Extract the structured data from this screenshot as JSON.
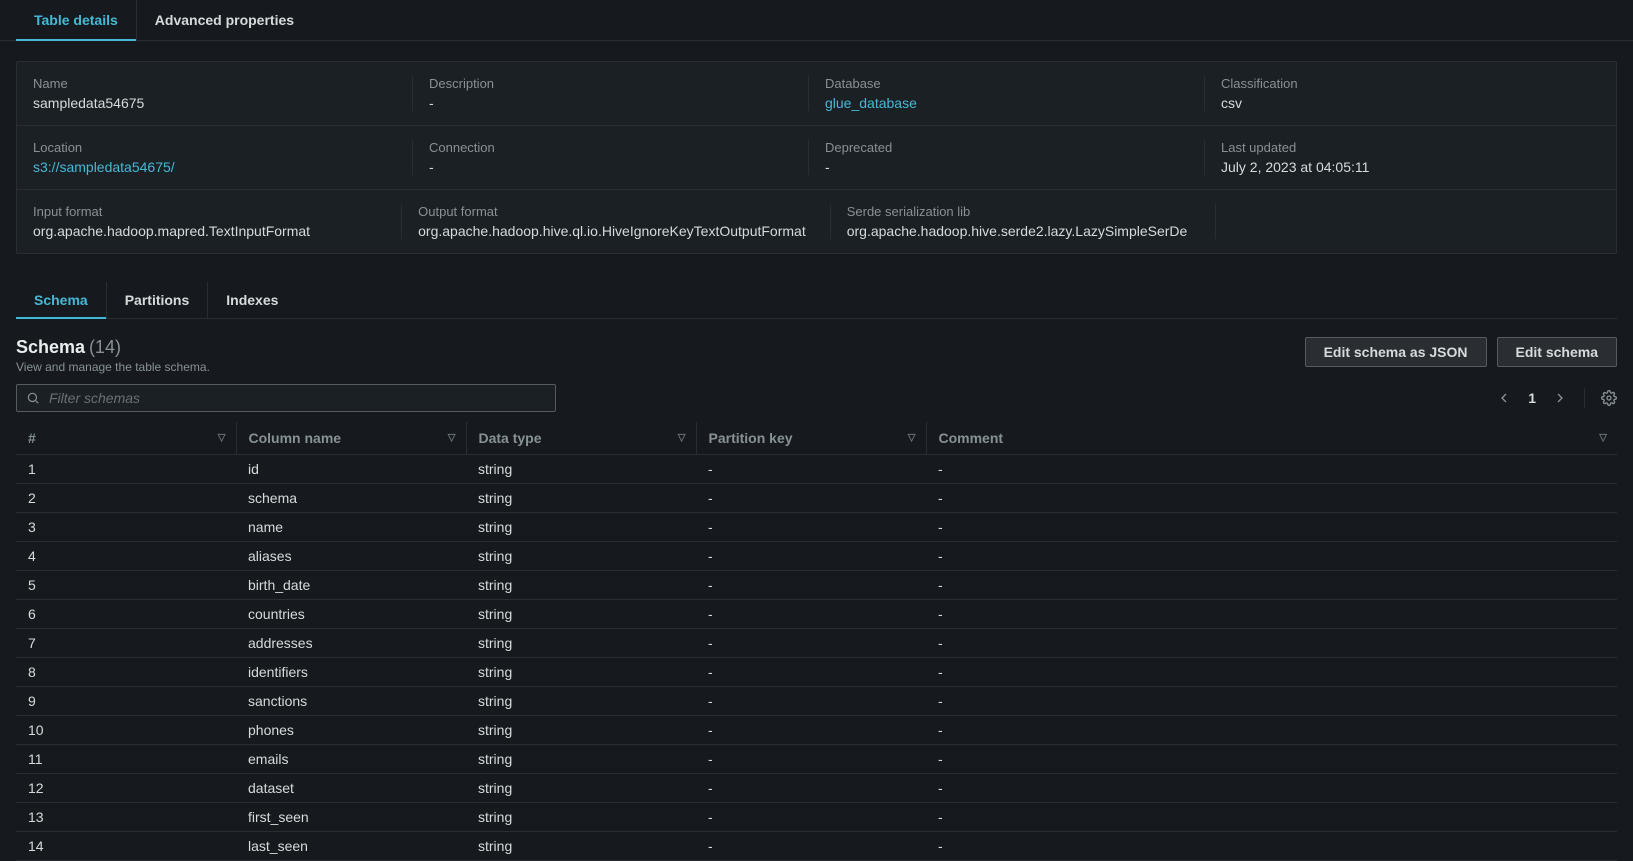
{
  "topTabs": {
    "details": "Table details",
    "advanced": "Advanced properties"
  },
  "details": {
    "row1": {
      "name": {
        "label": "Name",
        "value": "sampledata54675"
      },
      "description": {
        "label": "Description",
        "value": "-"
      },
      "database": {
        "label": "Database",
        "value": "glue_database"
      },
      "classification": {
        "label": "Classification",
        "value": "csv"
      }
    },
    "row2": {
      "location": {
        "label": "Location",
        "value": "s3://sampledata54675/"
      },
      "connection": {
        "label": "Connection",
        "value": "-"
      },
      "deprecated": {
        "label": "Deprecated",
        "value": "-"
      },
      "lastUpdated": {
        "label": "Last updated",
        "value": "July 2, 2023 at 04:05:11"
      }
    },
    "row3": {
      "inputFormat": {
        "label": "Input format",
        "value": "org.apache.hadoop.mapred.TextInputFormat"
      },
      "outputFormat": {
        "label": "Output format",
        "value": "org.apache.hadoop.hive.ql.io.HiveIgnoreKeyTextOutputFormat"
      },
      "serde": {
        "label": "Serde serialization lib",
        "value": "org.apache.hadoop.hive.serde2.lazy.LazySimpleSerDe"
      }
    }
  },
  "subTabs": {
    "schema": "Schema",
    "partitions": "Partitions",
    "indexes": "Indexes"
  },
  "schemaHeader": {
    "title": "Schema",
    "count": "(14)",
    "subtitle": "View and manage the table schema.",
    "editJson": "Edit schema as JSON",
    "edit": "Edit schema"
  },
  "search": {
    "placeholder": "Filter schemas"
  },
  "pager": {
    "page": "1"
  },
  "columns": {
    "num": "#",
    "name": "Column name",
    "type": "Data type",
    "partition": "Partition key",
    "comment": "Comment"
  },
  "rows": [
    {
      "n": "1",
      "name": "id",
      "type": "string",
      "part": "-",
      "comment": "-"
    },
    {
      "n": "2",
      "name": "schema",
      "type": "string",
      "part": "-",
      "comment": "-"
    },
    {
      "n": "3",
      "name": "name",
      "type": "string",
      "part": "-",
      "comment": "-"
    },
    {
      "n": "4",
      "name": "aliases",
      "type": "string",
      "part": "-",
      "comment": "-"
    },
    {
      "n": "5",
      "name": "birth_date",
      "type": "string",
      "part": "-",
      "comment": "-"
    },
    {
      "n": "6",
      "name": "countries",
      "type": "string",
      "part": "-",
      "comment": "-"
    },
    {
      "n": "7",
      "name": "addresses",
      "type": "string",
      "part": "-",
      "comment": "-"
    },
    {
      "n": "8",
      "name": "identifiers",
      "type": "string",
      "part": "-",
      "comment": "-"
    },
    {
      "n": "9",
      "name": "sanctions",
      "type": "string",
      "part": "-",
      "comment": "-"
    },
    {
      "n": "10",
      "name": "phones",
      "type": "string",
      "part": "-",
      "comment": "-"
    },
    {
      "n": "11",
      "name": "emails",
      "type": "string",
      "part": "-",
      "comment": "-"
    },
    {
      "n": "12",
      "name": "dataset",
      "type": "string",
      "part": "-",
      "comment": "-"
    },
    {
      "n": "13",
      "name": "first_seen",
      "type": "string",
      "part": "-",
      "comment": "-"
    },
    {
      "n": "14",
      "name": "last_seen",
      "type": "string",
      "part": "-",
      "comment": "-"
    }
  ]
}
